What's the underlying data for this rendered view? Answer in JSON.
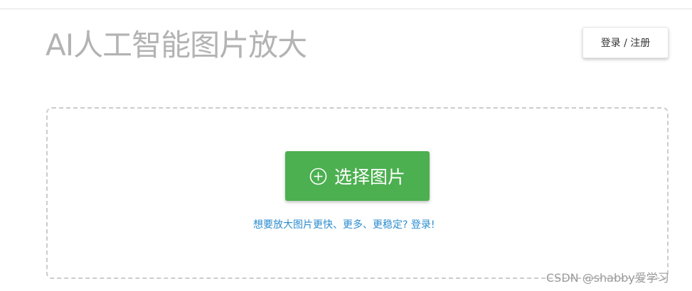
{
  "header": {
    "title": "AI人工智能图片放大",
    "login_label": "登录 / 注册"
  },
  "upload": {
    "button_label": "选择图片",
    "button_icon": "plus-circle-icon",
    "hint_link": "想要放大图片更快、更多、更稳定? 登录!"
  },
  "watermark": "CSDN @shabby爱学习",
  "colors": {
    "accent_green": "#4caf50",
    "link_blue": "#2b8ccf",
    "title_gray": "#b3b3b3"
  }
}
